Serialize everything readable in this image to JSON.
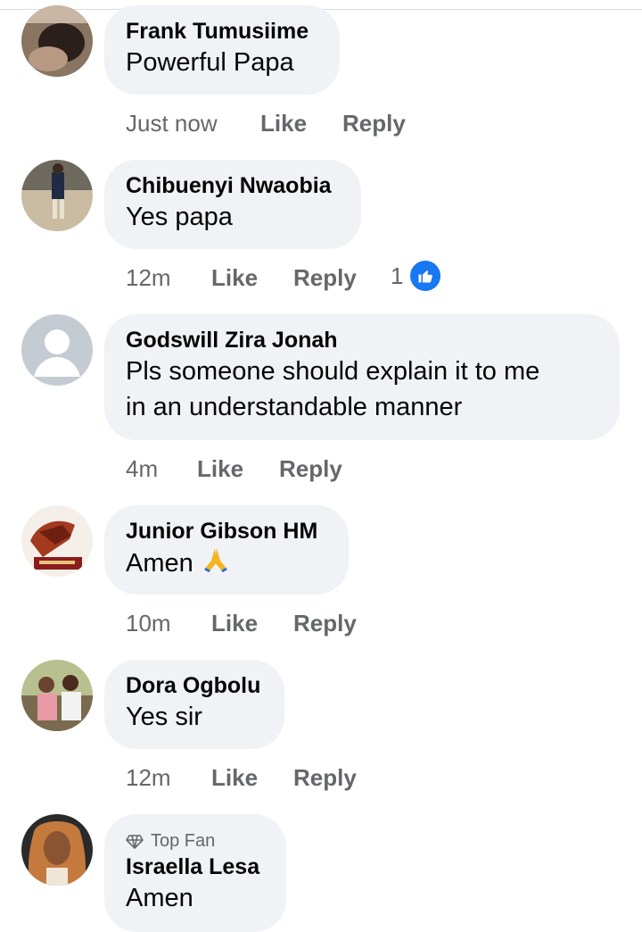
{
  "comments": [
    {
      "name": "Frank Tumusiime",
      "text": "Powerful Papa",
      "time": "Just now",
      "like": "Like",
      "reply": "Reply"
    },
    {
      "name": "Chibuenyi Nwaobia",
      "text": "Yes papa",
      "time": "12m",
      "like": "Like",
      "reply": "Reply",
      "reaction_count": "1"
    },
    {
      "name": "Godswill Zira Jonah",
      "text_line1": "Pls someone should explain it to me",
      "text_line2": "in an understandable manner",
      "time": "4m",
      "like": "Like",
      "reply": "Reply"
    },
    {
      "name": "Junior Gibson HM",
      "text": "Amen",
      "time": "10m",
      "like": "Like",
      "reply": "Reply"
    },
    {
      "name": "Dora Ogbolu",
      "text": "Yes sir",
      "time": "12m",
      "like": "Like",
      "reply": "Reply"
    },
    {
      "badge": "Top Fan",
      "name": "Israella Lesa",
      "text": "Amen"
    }
  ],
  "colors": {
    "bubble": "#f0f2f5",
    "meta": "#65676b",
    "like_blue": "#1877f2"
  },
  "icons": {
    "reaction": "thumbs-up-icon",
    "badge": "diamond-icon",
    "emoji": "folded-hands-icon"
  }
}
